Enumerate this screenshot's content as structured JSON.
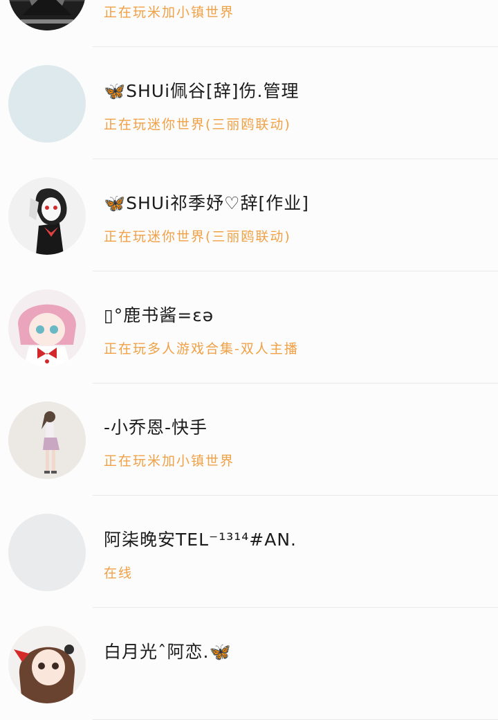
{
  "friends": [
    {
      "name": "",
      "status": "正在玩米加小镇世界",
      "avatar": "dark-anime-avatar"
    },
    {
      "name": "🦋SHUi佩谷[辞]伤.管理",
      "status": "正在玩迷你世界(三丽鸥联动)",
      "avatar": "blank-avatar",
      "avatar_color": "#dde9ec"
    },
    {
      "name": "🦋SHUi祁季妤♡辞[作业]",
      "status": "正在玩迷你世界(三丽鸥联动)",
      "avatar": "masked-anime-avatar"
    },
    {
      "name": "▯°鹿书酱=ɛə",
      "status": "正在玩多人游戏合集-双人主播",
      "avatar": "pink-hair-anime-avatar"
    },
    {
      "name": "-小乔恩-快手",
      "status": "正在玩米加小镇世界",
      "avatar": "standing-figure-avatar"
    },
    {
      "name": "阿柒晚安TEL⁻¹³¹⁴#AN.",
      "status": "在线",
      "avatar": "blank-avatar",
      "avatar_color": "#e9ebec"
    },
    {
      "name": "白月光ˆ阿恋.🦋",
      "status": "",
      "avatar": "brown-hair-anime-avatar"
    }
  ],
  "colors": {
    "status_text": "#f0a045",
    "name_text": "#1b1b1b",
    "divider": "#e9e9e9",
    "background": "#fcfcfc"
  }
}
